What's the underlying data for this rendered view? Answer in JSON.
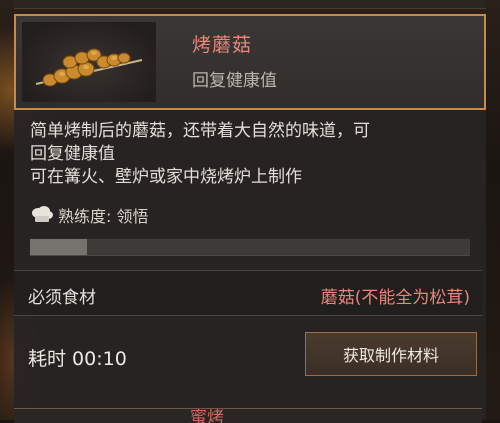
{
  "item": {
    "name": "烤蘑菇",
    "subtitle": "回复健康值",
    "icon": "mushroom-skewer-icon"
  },
  "description": [
    "简单烤制后的蘑菇，还带着大自然的味道，可",
    "回复健康值",
    "可在篝火、壁炉或家中烧烤炉上制作"
  ],
  "proficiency": {
    "icon": "chef-hat-icon",
    "label": "熟练度: 领悟",
    "progress_fraction": 0.13
  },
  "ingredients": {
    "label": "必须食材",
    "value": "蘑菇(不能全为松茸)"
  },
  "craft": {
    "time_label": "耗时 00:10",
    "button_label": "获取制作材料"
  },
  "next_item": {
    "name_fragment": "蜜烤"
  },
  "colors": {
    "accent_border": "#c9884c",
    "name_red": "#e9857a",
    "panel_bg": "#28252300"
  }
}
